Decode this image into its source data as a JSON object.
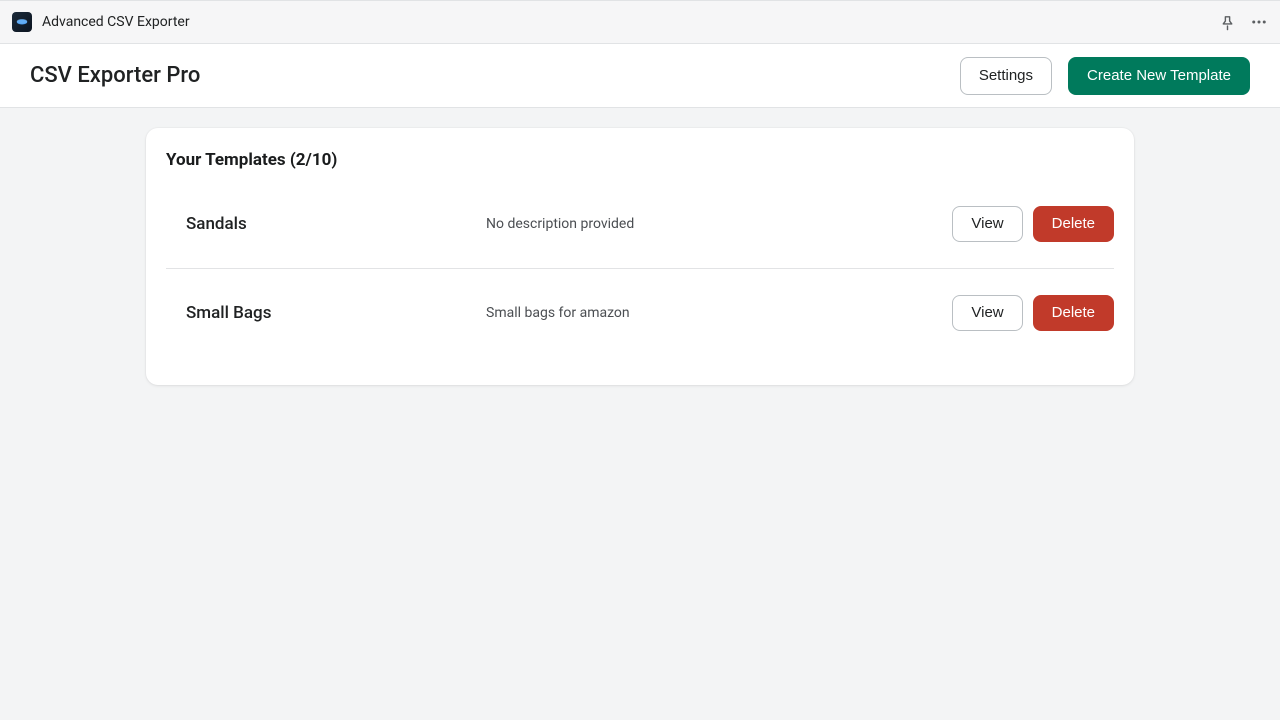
{
  "topbar": {
    "app_name": "Advanced CSV Exporter"
  },
  "header": {
    "title": "CSV Exporter Pro",
    "settings_label": "Settings",
    "create_label": "Create New Template"
  },
  "templates": {
    "heading": "Your Templates (2/10)",
    "view_label": "View",
    "delete_label": "Delete",
    "items": [
      {
        "name": "Sandals",
        "description": "No description provided"
      },
      {
        "name": "Small Bags",
        "description": "Small bags for amazon"
      }
    ]
  }
}
